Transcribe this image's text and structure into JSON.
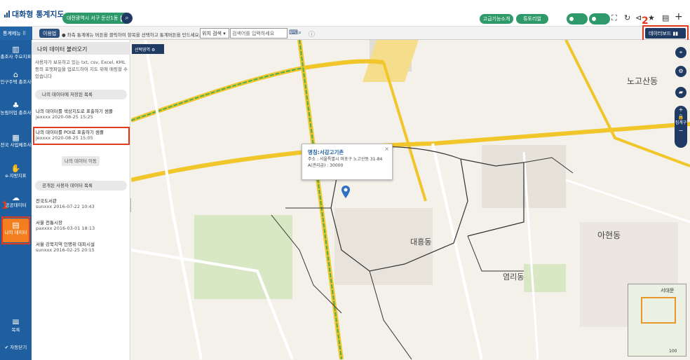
{
  "header": {
    "app_title": "대화형 통계지도",
    "region": "대전광역시 서구 둔산1동",
    "btn_intro": "고급기능소개",
    "btn_tutorial": "튜토리얼"
  },
  "subbar": {
    "menu_label": "통계메뉴",
    "usage_label": "이용법",
    "hint": "좌측 통계메뉴 버튼을 클릭하여 항목을 선택하고 통계버튼을 만드세요.",
    "location_select": "위치 검색",
    "address_placeholder": "검색어를 입력하세요",
    "dashboard_label": "데이터보드"
  },
  "sidebar": {
    "items": [
      {
        "label": "총조사 주요지표",
        "icon": "chart-icon"
      },
      {
        "label": "인구주택 총조사",
        "icon": "house-icon"
      },
      {
        "label": "농림어업 총조사",
        "icon": "farm-icon"
      },
      {
        "label": "전국 사업체조사",
        "icon": "building-icon"
      },
      {
        "label": "e-지방지표",
        "icon": "hand-icon"
      },
      {
        "label": "공공데이터",
        "icon": "cloud-icon"
      },
      {
        "label": "나의 데이터",
        "icon": "user-doc-icon"
      }
    ],
    "bottom_label": "목록",
    "auto_close": "자동닫기"
  },
  "panel": {
    "title": "나의 데이터 불러오기",
    "description": "사용자가 보유하고 있는 txt, csv, Excel, KML 등의 포맷파일을 업로드하여 지도 위에 매핑할 수 있습니다",
    "saved_header": "나의 데이터에 저장된 목록",
    "saved": [
      {
        "name": "나의 데이터를 색상지도로 표출하기 샘플",
        "meta": "jexxxx 2020-08-25 15:25"
      },
      {
        "name": "나의 데이터를 POI로 표출하기 샘플",
        "meta": "jexxxx 2020-08-25 15:05"
      }
    ],
    "move_btn": "나의 데이터 이동",
    "public_header": "공개된 사용자 데이터 목록",
    "public": [
      {
        "name": "전국도서관",
        "meta": "sunxxx 2016-07-22 10:43"
      },
      {
        "name": "서울 전통시장",
        "meta": "paxxxx 2016-03-01 18:13"
      },
      {
        "name": "서울 강북지역 인명위 대피시설",
        "meta": "sunxxx 2016-02-25 20:15"
      }
    ]
  },
  "map": {
    "select_area": "선택영역",
    "popup": {
      "title": "명칭:서강고기촌",
      "address": "주소 : 서울특별시 마포구 노고산동 31-84",
      "value": "A(관리급) : 30000"
    },
    "district_labels": [
      "대흥동",
      "염리동",
      "아현동",
      "노고산동"
    ],
    "zoom_labels": [
      "+",
      "집계구",
      "−"
    ],
    "minimap_label": "서대문",
    "scale": "100"
  },
  "annotations": {
    "tag1": "1",
    "tag2": "2"
  }
}
